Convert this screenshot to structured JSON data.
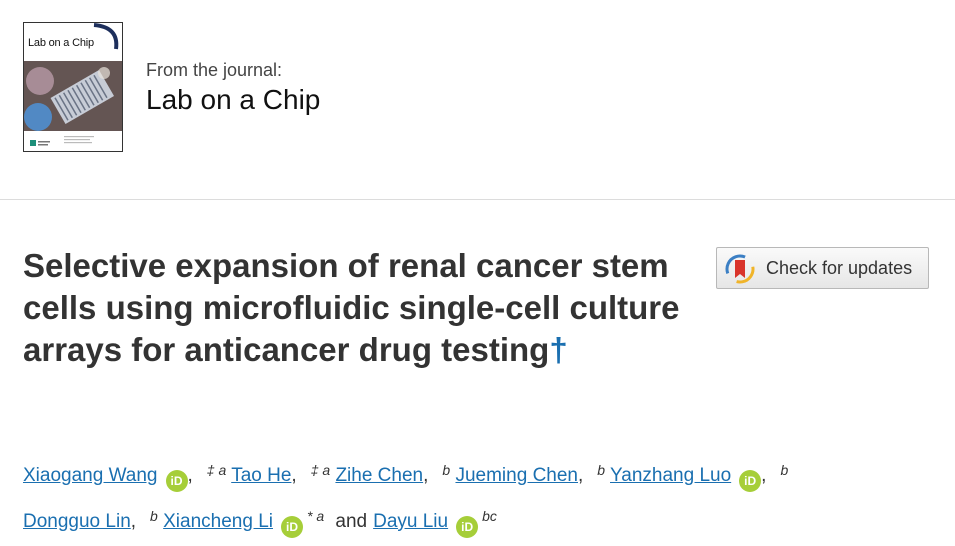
{
  "journal": {
    "cover_title": "Lab on a Chip",
    "from_label": "From the journal:",
    "name": "Lab on a Chip"
  },
  "article": {
    "title": "Selective expansion of renal cancer stem cells using microfluidic single-cell culture arrays for anticancer drug testing",
    "dagger": "†"
  },
  "check_updates": {
    "label": "Check for updates"
  },
  "authors": [
    {
      "name": "Xiaogang Wang",
      "orcid": true,
      "marks": "‡ a"
    },
    {
      "name": "Tao He",
      "orcid": false,
      "marks": "‡ a"
    },
    {
      "name": "Zihe Chen",
      "orcid": false,
      "marks": "b"
    },
    {
      "name": "Jueming Chen",
      "orcid": false,
      "marks": "b"
    },
    {
      "name": "Yanzhang Luo",
      "orcid": true,
      "marks": "b"
    },
    {
      "name": "Dongguo Lin",
      "orcid": false,
      "marks": "b"
    },
    {
      "name": "Xiancheng Li",
      "orcid": true,
      "marks": "* a"
    },
    {
      "name": "Dayu Liu",
      "orcid": true,
      "marks": "bc"
    }
  ],
  "authors_conjunction": "and",
  "orcid_icon_text": "iD",
  "colors": {
    "link": "#1a6fb0",
    "orcid": "#a6ce39",
    "title": "#333333"
  }
}
